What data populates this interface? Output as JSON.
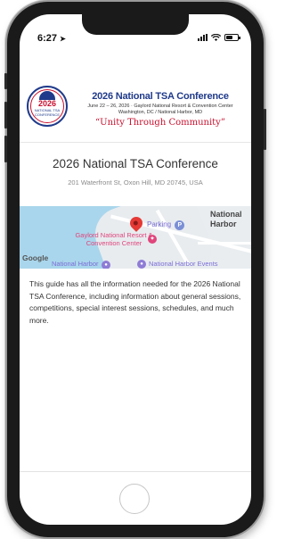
{
  "status_bar": {
    "time": "6:27"
  },
  "banner": {
    "seal_year": "2026",
    "seal_subtitle": "NATIONAL TSA CONFERENCE",
    "title": "2026 National TSA Conference",
    "dates": "June 22 – 26, 2026 · Gaylord National Resort & Convention Center",
    "place": "Washington, DC / National Harbor, MD",
    "motto": "“Unity Through Community”"
  },
  "event": {
    "title": "2026 National TSA Conference",
    "address": "201 Waterfront St, Oxon Hill, MD 20745, USA"
  },
  "map": {
    "label_parking": "Parking",
    "label_parking_badge": "P",
    "label_national_harbor": "National Harbor",
    "label_venue": "Gaylord National Resort & Convention Center",
    "label_google": "Google",
    "label_harbor_left": "National Harbor",
    "label_events": "National Harbor Events"
  },
  "description": "This guide has all the information needed for the 2026 National TSA Conference, including information about general sessions, competitions, special interest sessions, schedules, and much more.",
  "colors": {
    "brand_blue": "#1f3a8a",
    "brand_red": "#c8102e",
    "pin_red": "#e53935"
  }
}
